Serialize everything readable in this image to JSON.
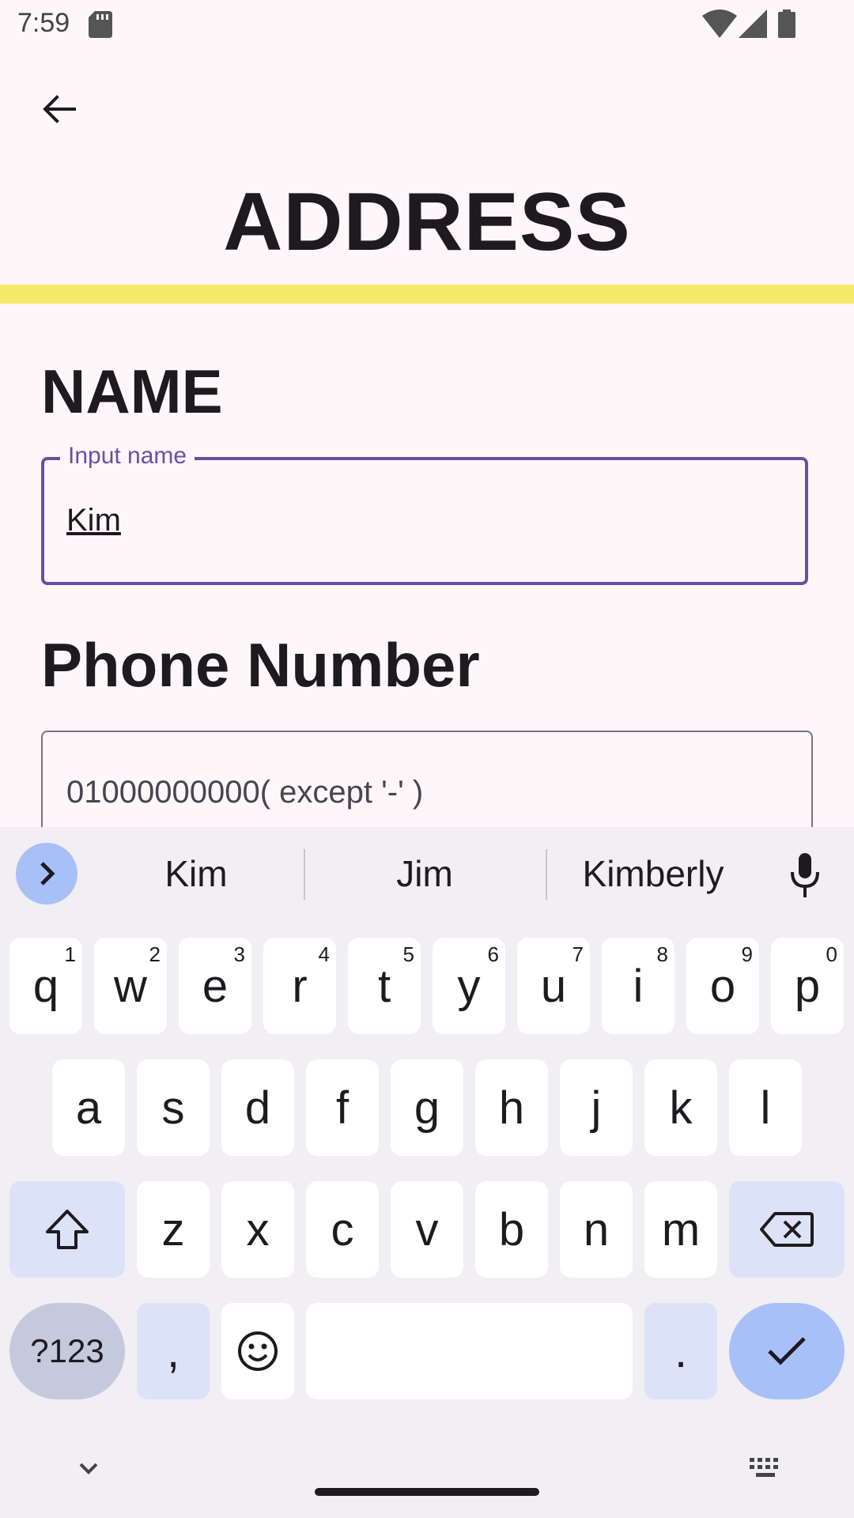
{
  "status": {
    "time": "7:59"
  },
  "header": {
    "title": "ADDRESS"
  },
  "form": {
    "name_heading": "NAME",
    "name_label": "Input name",
    "name_value": "Kim",
    "phone_heading": "Phone Number",
    "phone_placeholder": "01000000000( except '-'  )"
  },
  "keyboard": {
    "suggestions": [
      "Kim",
      "Jim",
      "Kimberly"
    ],
    "row1": [
      {
        "key": "q",
        "hint": "1"
      },
      {
        "key": "w",
        "hint": "2"
      },
      {
        "key": "e",
        "hint": "3"
      },
      {
        "key": "r",
        "hint": "4"
      },
      {
        "key": "t",
        "hint": "5"
      },
      {
        "key": "y",
        "hint": "6"
      },
      {
        "key": "u",
        "hint": "7"
      },
      {
        "key": "i",
        "hint": "8"
      },
      {
        "key": "o",
        "hint": "9"
      },
      {
        "key": "p",
        "hint": "0"
      }
    ],
    "row2": [
      "a",
      "s",
      "d",
      "f",
      "g",
      "h",
      "j",
      "k",
      "l"
    ],
    "row3": [
      "z",
      "x",
      "c",
      "v",
      "b",
      "n",
      "m"
    ],
    "symbols_label": "?123",
    "comma_label": ",",
    "period_label": "."
  },
  "colors": {
    "accent": "#6750a4",
    "highlight_bar": "#f4ec68",
    "key_special": "#dce3f8",
    "enter": "#a8c0f8"
  }
}
